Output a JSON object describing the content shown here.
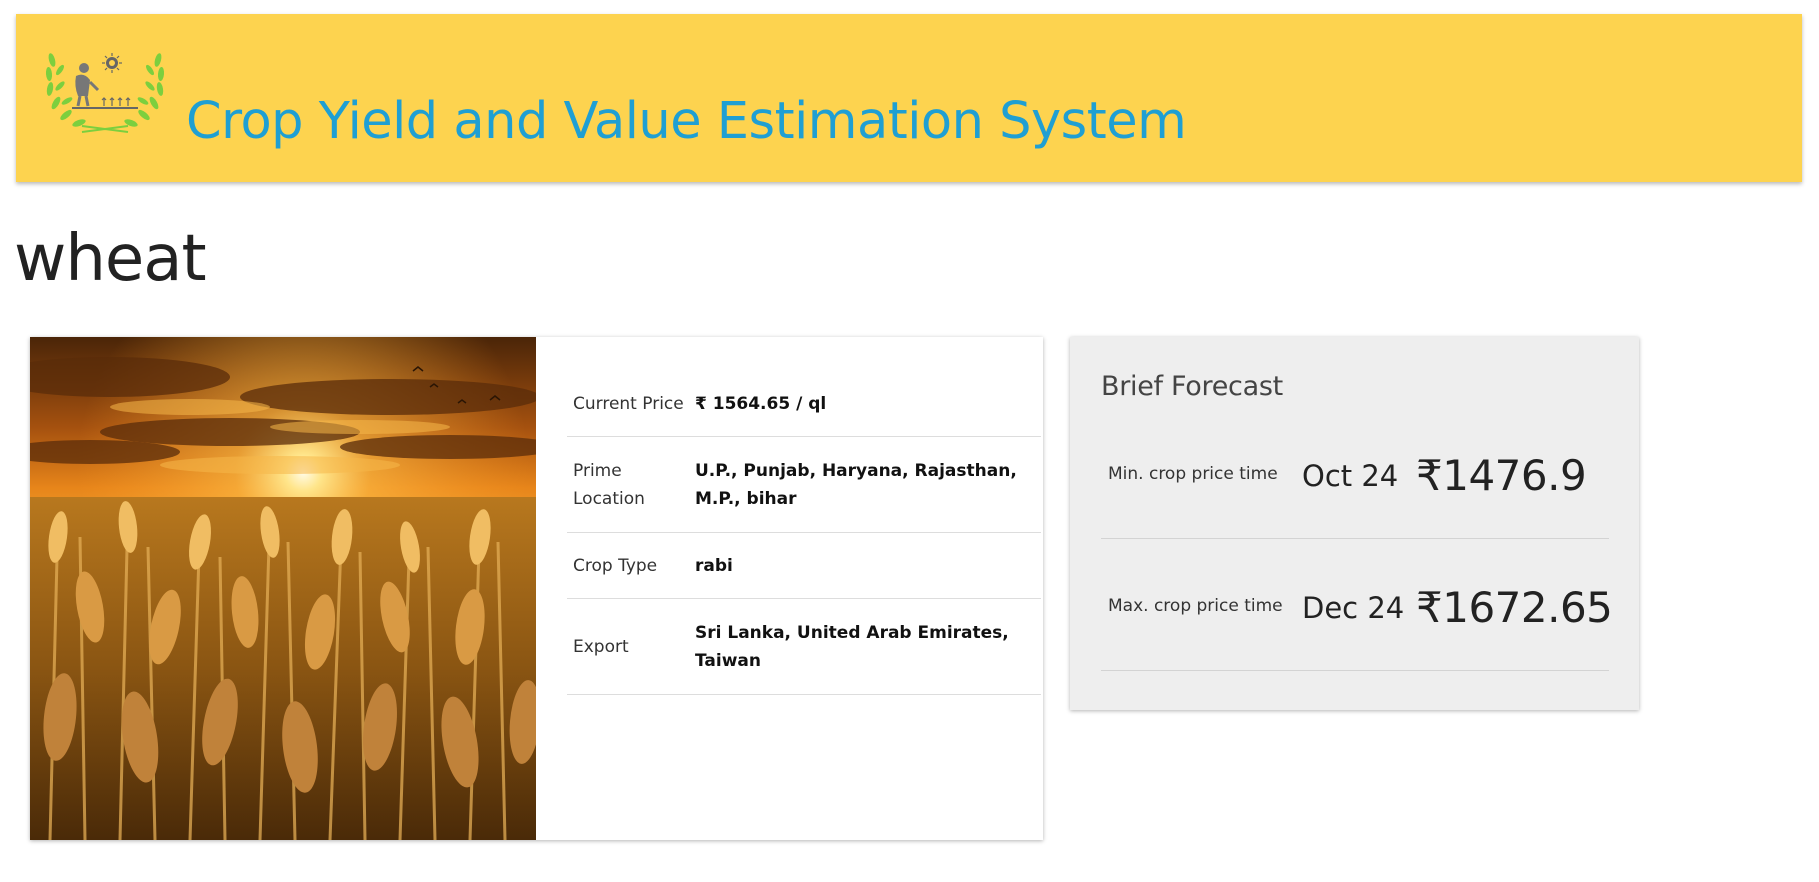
{
  "header": {
    "title": "Crop Yield and Value Estimation System",
    "logo_icon": "farmer-wreath-logo-icon",
    "background_color": "#fdd34f",
    "title_color": "#1f9fd3"
  },
  "crop": {
    "name": "wheat",
    "image_icon": "wheat-field-sunset-photo"
  },
  "details": {
    "current_price_label": "Current Price",
    "current_price_value": "₹ 1564.65 / ql",
    "prime_location_label": "Prime Location",
    "prime_location_value": "U.P., Punjab, Haryana, Rajasthan, M.P., bihar",
    "crop_type_label": "Crop Type",
    "crop_type_value": "rabi",
    "export_label": "Export",
    "export_value": "Sri Lanka, United Arab Emirates, Taiwan"
  },
  "forecast": {
    "title": "Brief Forecast",
    "min": {
      "label": "Min. crop price time",
      "date": "Oct 24",
      "price": "₹1476.9"
    },
    "max": {
      "label": "Max. crop price time",
      "date": "Dec 24",
      "price": "₹1672.65"
    }
  }
}
